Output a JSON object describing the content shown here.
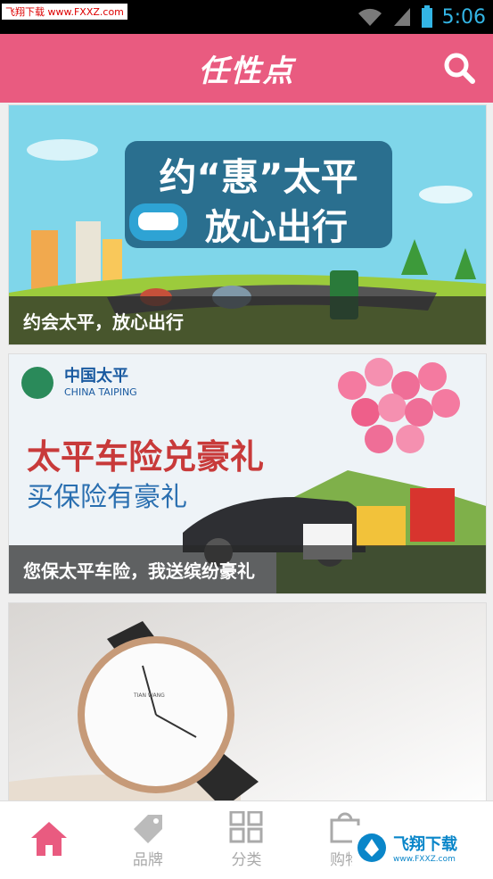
{
  "status_bar": {
    "watermark": "飞翔下载 www.FXXZ.com",
    "time": "5:06"
  },
  "header": {
    "title": "任性点"
  },
  "feed": {
    "cards": [
      {
        "banner_title_1": "约“惠”太平",
        "banner_title_2": "放心出行",
        "caption": "约会太平，放心出行"
      },
      {
        "logo_cn": "中国太平",
        "logo_en": "CHINA TAIPING",
        "banner_title_1": "太平车险兑豪礼",
        "banner_title_2": "买保险有豪礼",
        "caption": "您保太平车险，我送缤纷豪礼"
      },
      {
        "watch_brand": "TIAN WANG"
      }
    ]
  },
  "bottom_nav": {
    "items": [
      {
        "label": "",
        "icon": "home-icon"
      },
      {
        "label": "品牌",
        "icon": "tag-icon"
      },
      {
        "label": "分类",
        "icon": "grid-icon"
      },
      {
        "label": "购物",
        "icon": "shopping-bag-icon"
      },
      {
        "label": "",
        "icon": "user-icon"
      }
    ]
  },
  "watermark_br": {
    "text": "飞翔下载",
    "url": "www.FXXZ.com"
  },
  "colors": {
    "accent": "#e95b80",
    "status_icon": "#33b5e5"
  }
}
